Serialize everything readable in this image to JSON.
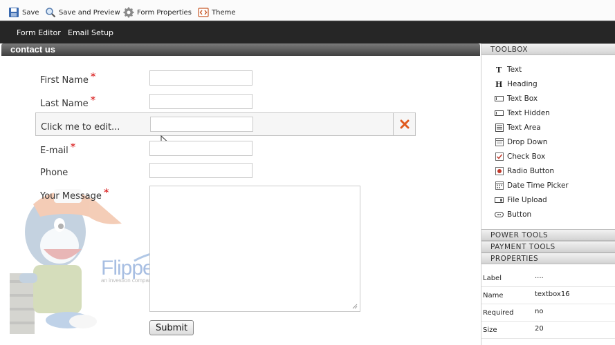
{
  "toolbar": {
    "save": "Save",
    "save_preview": "Save and Preview",
    "form_properties": "Form Properties",
    "theme": "Theme"
  },
  "nav": {
    "form_editor": "Form Editor",
    "email_setup": "Email Setup"
  },
  "form": {
    "title": "contact us",
    "fields": {
      "first_name": "First Name",
      "last_name": "Last Name",
      "edit_placeholder": "Click me to edit...",
      "email": "E-mail",
      "phone": "Phone",
      "message": "Your Message"
    },
    "required_mark": "*",
    "submit": "Submit",
    "logo": "FlipperHost",
    "logo_tagline": "an investion company"
  },
  "toolbox": {
    "header": "TOOLBOX",
    "items": [
      {
        "label": "Text",
        "icon": "text-icon"
      },
      {
        "label": "Heading",
        "icon": "heading-icon"
      },
      {
        "label": "Text Box",
        "icon": "textbox-icon"
      },
      {
        "label": "Text Hidden",
        "icon": "text-hidden-icon"
      },
      {
        "label": "Text Area",
        "icon": "textarea-icon"
      },
      {
        "label": "Drop Down",
        "icon": "dropdown-icon"
      },
      {
        "label": "Check Box",
        "icon": "checkbox-icon"
      },
      {
        "label": "Radio Button",
        "icon": "radio-icon"
      },
      {
        "label": "Date Time Picker",
        "icon": "calendar-icon"
      },
      {
        "label": "File Upload",
        "icon": "file-upload-icon"
      },
      {
        "label": "Button",
        "icon": "button-icon"
      }
    ]
  },
  "panels": {
    "power_tools": "POWER TOOLS",
    "payment_tools": "PAYMENT TOOLS",
    "properties": "PROPERTIES"
  },
  "properties": [
    {
      "label": "Label",
      "value": "...."
    },
    {
      "label": "Name",
      "value": "textbox16"
    },
    {
      "label": "Required",
      "value": "no"
    },
    {
      "label": "Size",
      "value": "20"
    }
  ],
  "colors": {
    "nav_bg": "#262626",
    "required": "#d40000",
    "delete_x": "#e05a1e"
  }
}
